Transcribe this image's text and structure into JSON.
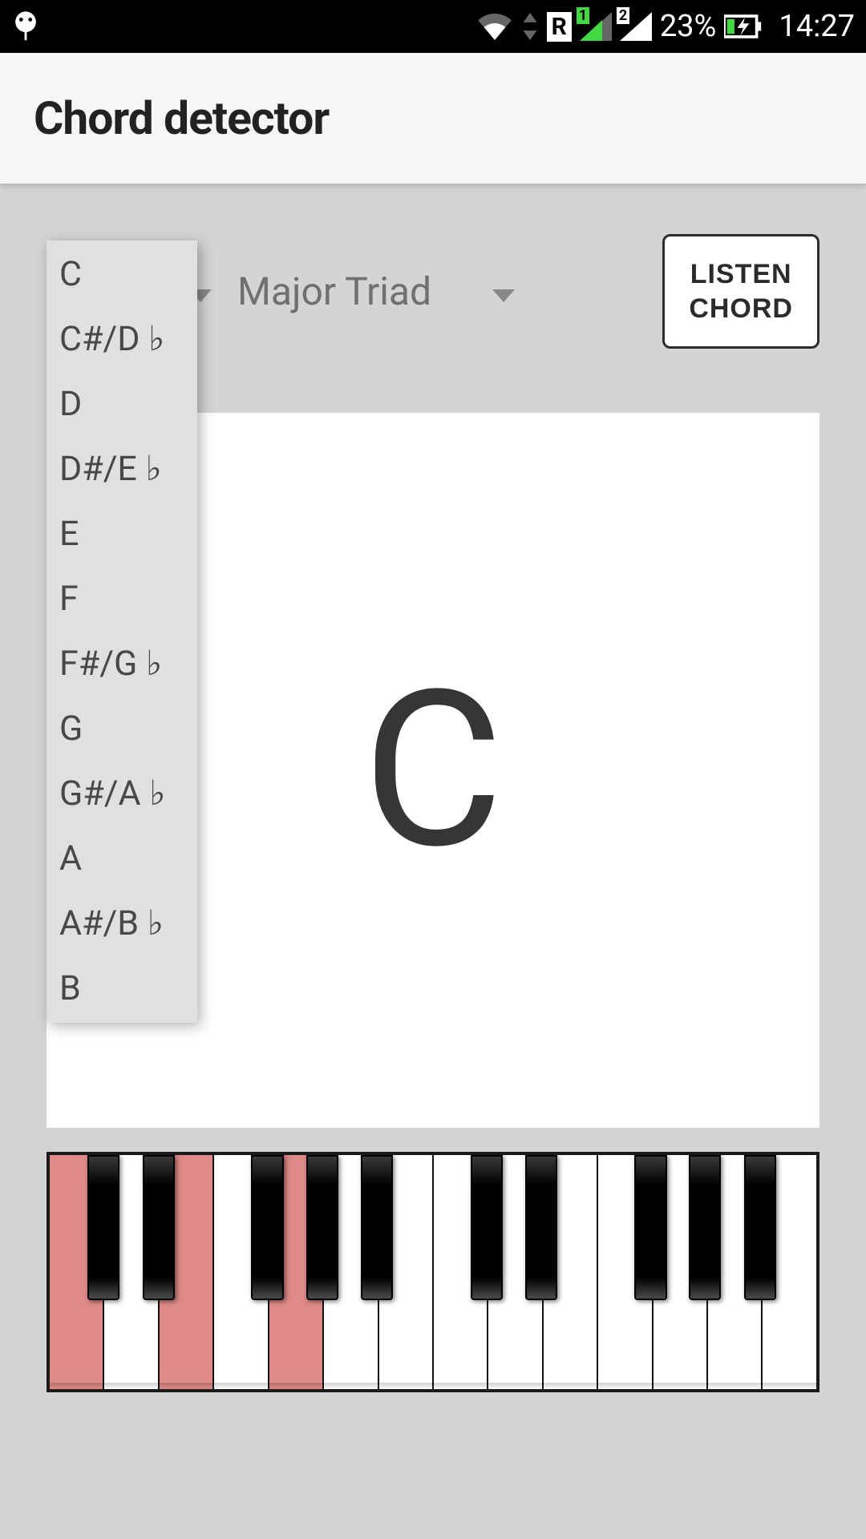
{
  "status_bar": {
    "battery_pct": "23%",
    "clock": "14:27",
    "roaming": "R",
    "sim1": "1",
    "sim2": "2"
  },
  "app": {
    "title": "Chord detector"
  },
  "controls": {
    "root_selected": "C",
    "chord_type_selected": "Major Triad",
    "listen_button": "LISTEN\nCHORD"
  },
  "chord_display": {
    "current_chord": "C"
  },
  "root_dropdown": {
    "items": [
      "C",
      "C#/D ♭",
      "D",
      "D#/E ♭",
      "E",
      "F",
      "F#/G ♭",
      "G",
      "G#/A ♭",
      "A",
      "A#/B ♭",
      "B"
    ]
  },
  "piano": {
    "white_keys": 14,
    "active_white_indices": [
      0,
      2,
      4
    ],
    "black_key_positions_pct": [
      4.9,
      12.1,
      26.3,
      33.5,
      40.6,
      54.9,
      62.0,
      76.3,
      83.4,
      90.6
    ]
  }
}
